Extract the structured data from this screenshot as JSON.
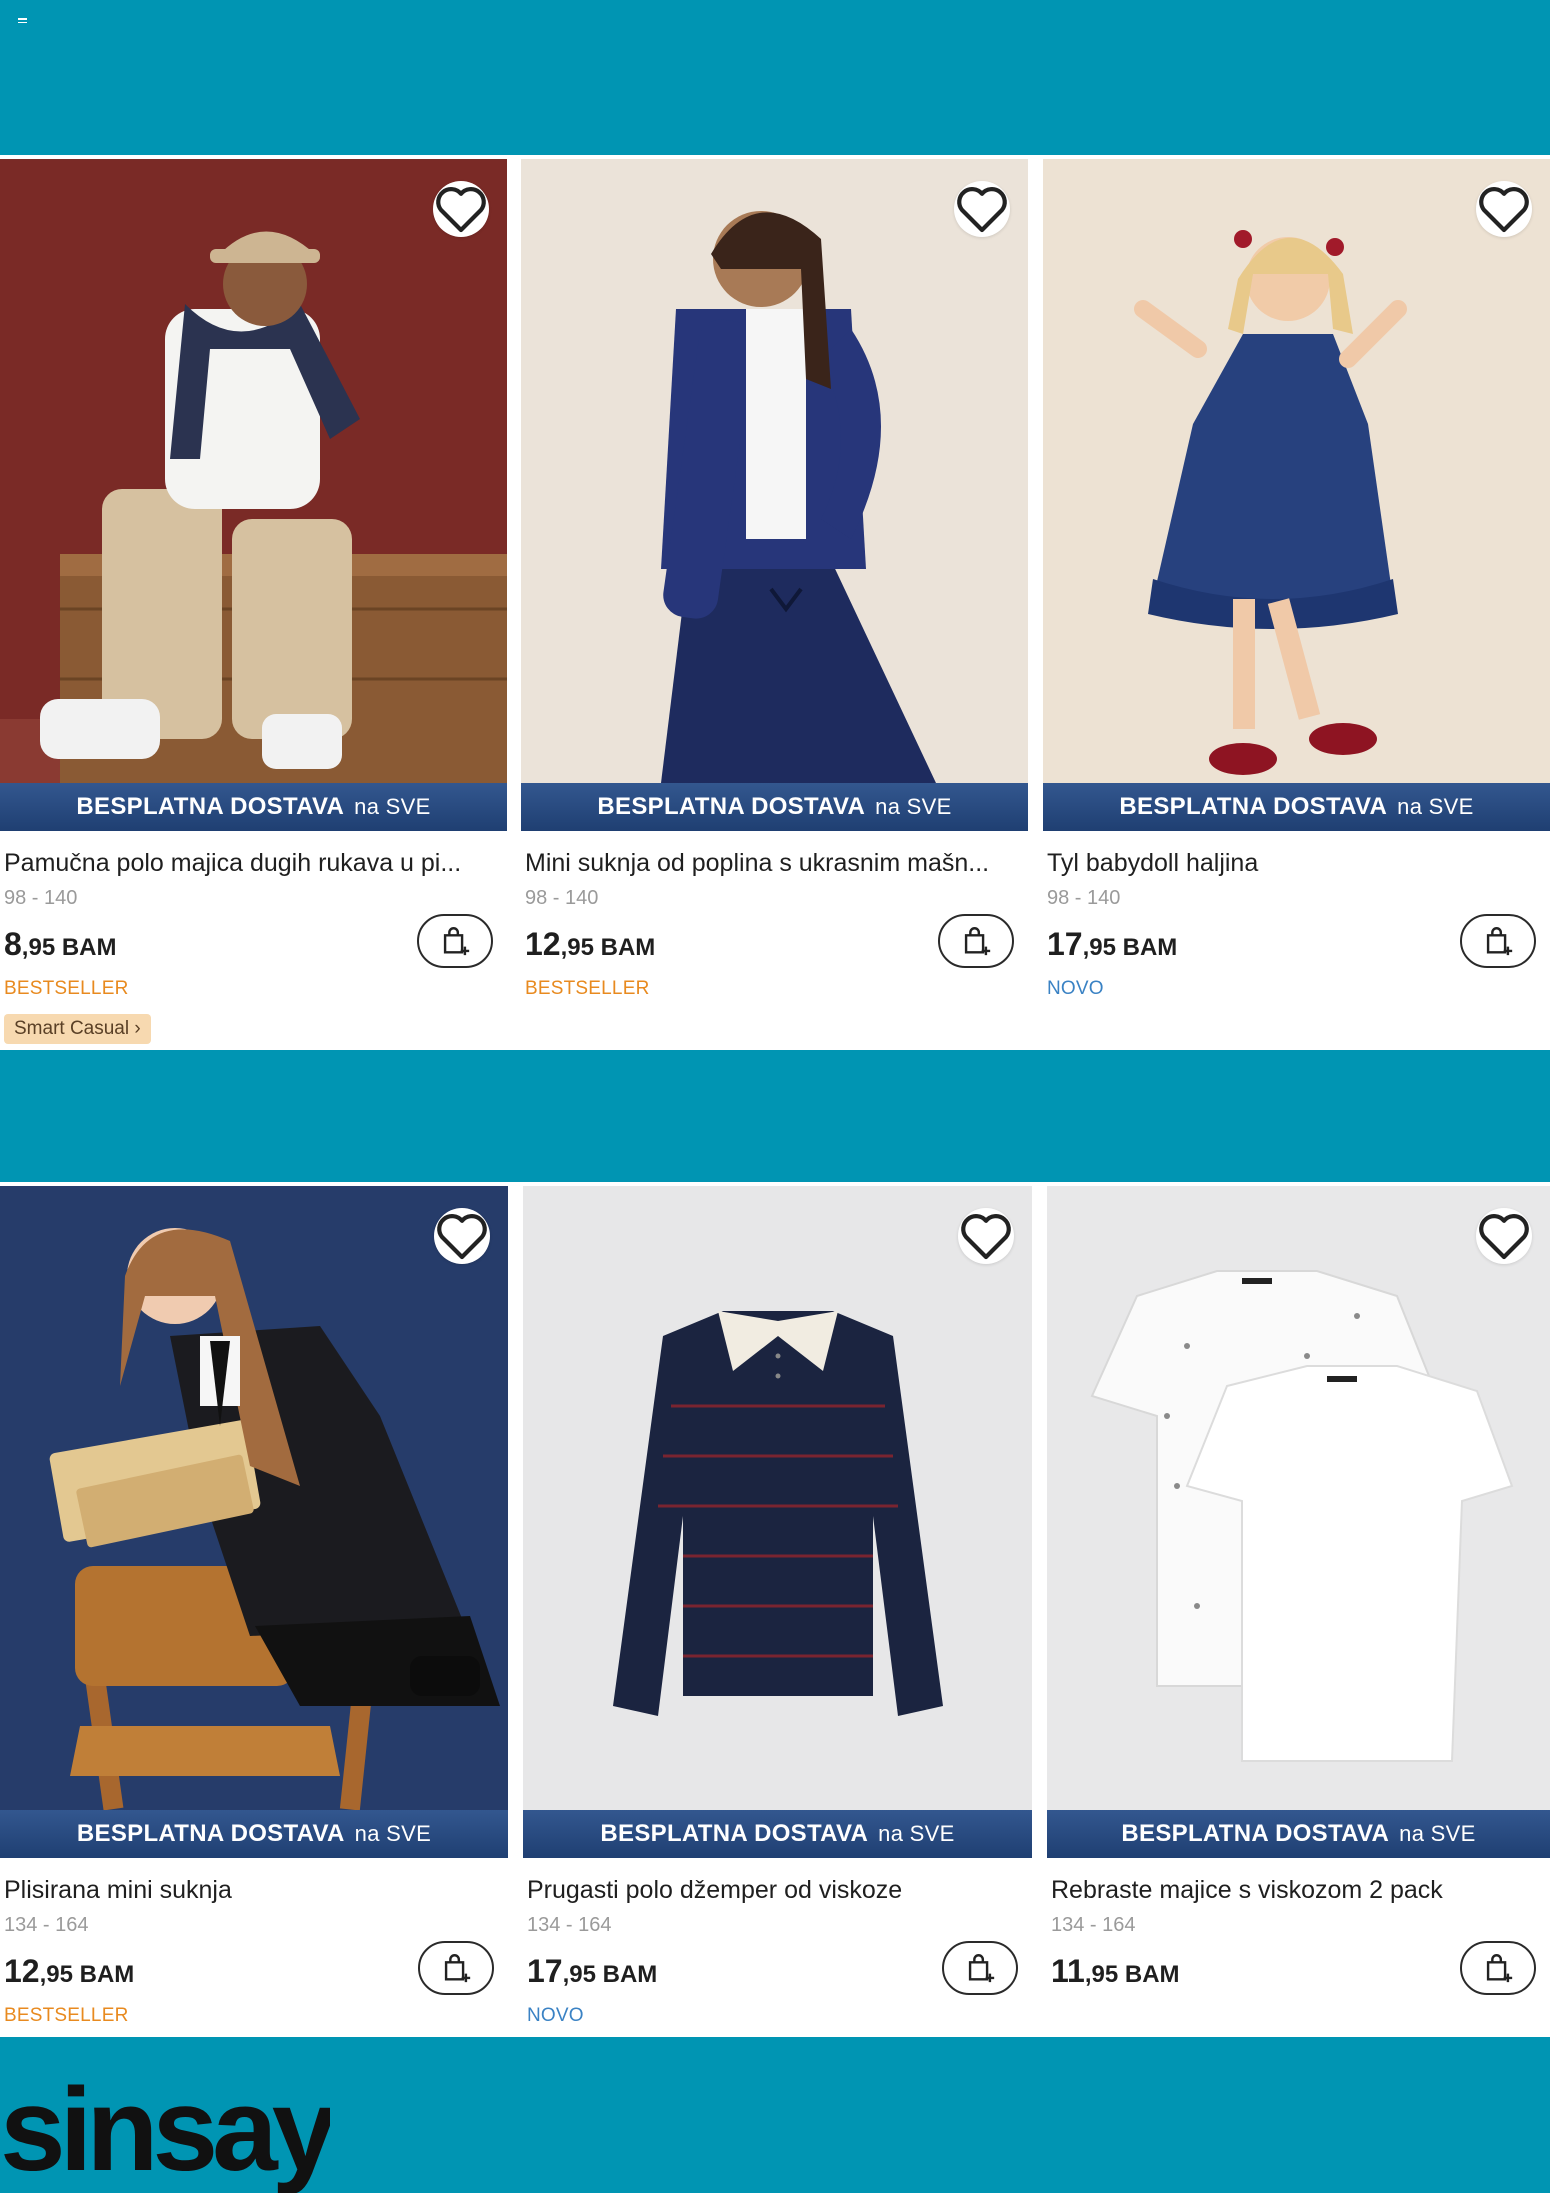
{
  "promo_banner": {
    "strong": "BESPLATNA DOSTAVA",
    "rest": "na SVE"
  },
  "products": [
    {
      "name": "Pamučna polo majica dugih rukava u pi...",
      "sizes": "98 - 140",
      "price_main": "8",
      "price_rest": ",95 BAM",
      "tag": "BESTSELLER",
      "chip": "Smart Casual ›",
      "image": "boy in cap, white polo and navy sweater sitting on a wooden crate"
    },
    {
      "name": "Mini suknja od poplina s ukrasnim mašn...",
      "sizes": "98 - 140",
      "price_main": "12",
      "price_rest": ",95 BAM",
      "tag": "BESTSELLER",
      "image": "girl in navy cardigan and navy pleated skirt"
    },
    {
      "name": "Tyl babydoll haljina",
      "sizes": "98 - 140",
      "price_main": "17",
      "price_rest": ",95 BAM",
      "tag": "NOVO",
      "image": "girl in navy tulle babydoll dress with red shoes"
    },
    {
      "name": "Plisirana mini suknja",
      "sizes": "134 - 164",
      "price_main": "12",
      "price_rest": ",95 BAM",
      "tag": "BESTSELLER",
      "image": "teen girl holding books, kneeling on a wooden chair"
    },
    {
      "name": "Prugasti polo džemper od viskoze",
      "sizes": "134 - 164",
      "price_main": "17",
      "price_rest": ",95 BAM",
      "tag": "NOVO",
      "image": "navy striped polo sweater with white collar"
    },
    {
      "name": "Rebraste majice s viskozom 2 pack",
      "sizes": "134 - 164",
      "price_main": "11",
      "price_rest": ",95 BAM",
      "tag": "",
      "image": "two white t-shirts, one with small print"
    }
  ],
  "brand": {
    "logo_text": "sinsay"
  },
  "colors": {
    "background": "#0095b3",
    "banner": "#2a4a80",
    "bestseller": "#e88a1f",
    "novo": "#3a82c4",
    "chip": "#f7d9b0"
  }
}
